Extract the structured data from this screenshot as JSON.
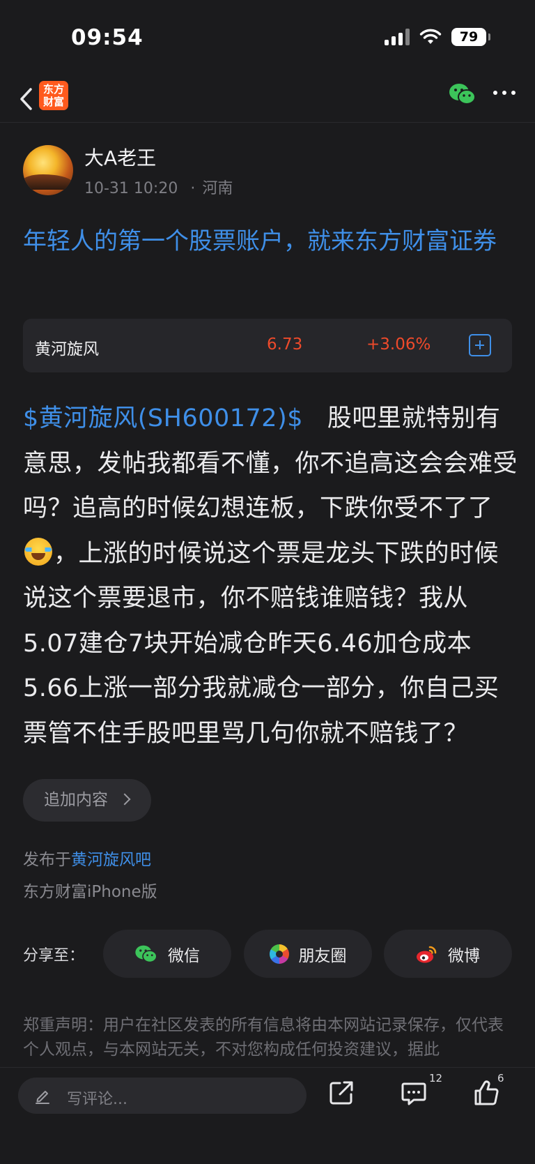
{
  "status_bar": {
    "time": "09:54",
    "battery": "79"
  },
  "nav": {
    "logo_text": "东方\n财富"
  },
  "author": {
    "name": "大A老王",
    "datetime": "10-31 10:20",
    "separator": "·",
    "location": "河南"
  },
  "post": {
    "title": "年轻人的第一个股票账户，就来东方财富证券",
    "stock_tag": "$黄河旋风(SH600172)$",
    "body_part1": "股吧里就特别有意思，发帖我都看不懂，你不追高这会会难受吗？追高的时候幻想连板，下跌你受不了了",
    "body_part2": "，上涨的时候说这个票是龙头下跌的时候说这个票要退市，你不赔钱谁赔钱？我从5.07建仓7块开始减仓昨天6.46加仓成本5.66上涨一部分我就减仓一部分，你自己买票管不住手股吧里骂几句你就不赔钱了？"
  },
  "stock_card": {
    "name": "黄河旋风",
    "price": "6.73",
    "change": "+3.06%"
  },
  "add_content_label": "追加内容",
  "published": {
    "prefix": "发布于",
    "bar_name": "黄河旋风吧",
    "platform": "东方财富iPhone版"
  },
  "share": {
    "label": "分享至：",
    "wechat": "微信",
    "moments": "朋友圈",
    "weibo": "微博"
  },
  "disclaimer": "郑重声明：用户在社区发表的所有信息将由本网站记录保存，仅代表个人观点，与本网站无关，不对您构成任何投资建议，据此",
  "bottom_bar": {
    "comment_placeholder": "写评论...",
    "comment_count": "12",
    "like_count": "6"
  },
  "colors": {
    "accent_blue": "#3f8fe8",
    "up_red": "#ee4a2b",
    "background": "#1b1b1d",
    "card": "#26262a"
  }
}
